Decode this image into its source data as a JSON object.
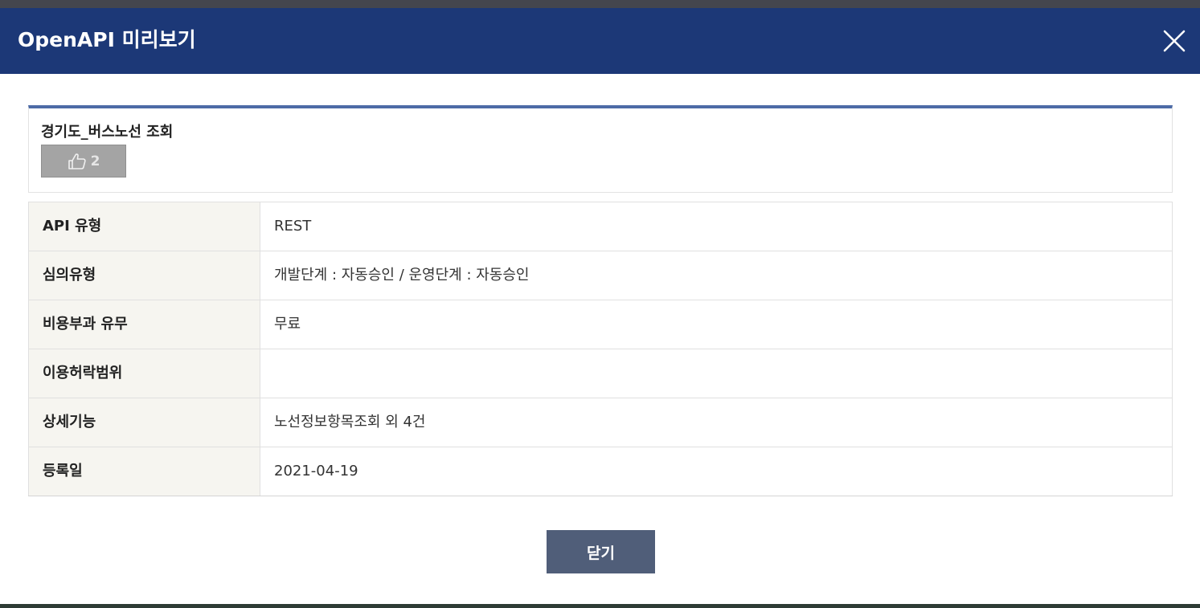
{
  "modal": {
    "title": "OpenAPI 미리보기",
    "close_icon": "close-icon"
  },
  "summary": {
    "api_name": "경기도_버스노선 조회",
    "like_icon": "thumbs-up-icon",
    "like_count": "2"
  },
  "details": {
    "rows": [
      {
        "label": "API 유형",
        "value": "REST"
      },
      {
        "label": "심의유형",
        "value": "개발단계 : 자동승인 / 운영단계 : 자동승인"
      },
      {
        "label": "비용부과 유무",
        "value": "무료"
      },
      {
        "label": "이용허락범위",
        "value": ""
      },
      {
        "label": "상세기능",
        "value": "노선정보항목조회 외 4건"
      },
      {
        "label": "등록일",
        "value": "2021-04-19"
      }
    ]
  },
  "footer": {
    "close_label": "닫기"
  },
  "colors": {
    "header_bg": "#1c3877",
    "summary_accent": "#4d6ba6",
    "label_bg": "#f6f5f0",
    "like_button_bg": "#a4a4a4",
    "close_button_bg": "#505e79"
  }
}
